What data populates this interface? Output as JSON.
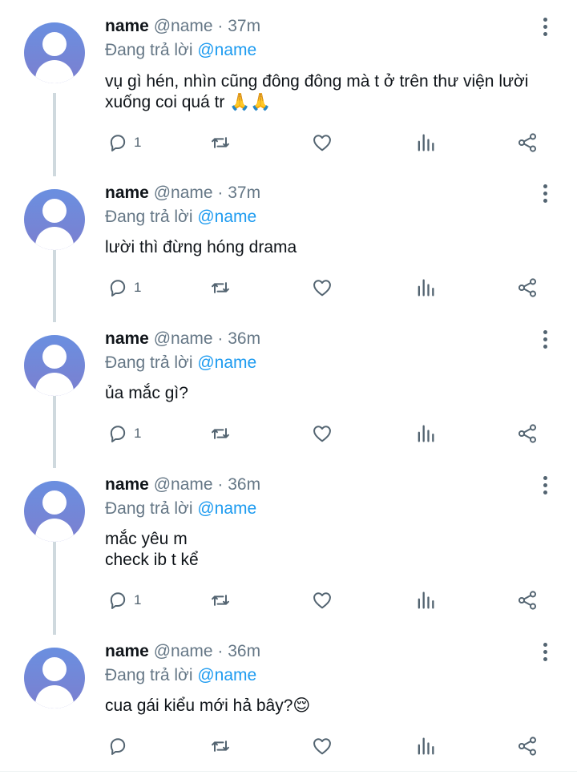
{
  "tweets": [
    {
      "name": "name",
      "handle": "@name · 37m",
      "reply_prefix": "Đang trả lời",
      "reply_to": "@name",
      "text": "vụ gì hén, nhìn cũng đông đông mà t ở trên thư viện lười\nxuống coi quá tr 🙏🙏",
      "reply_count": "1"
    },
    {
      "name": "name",
      "handle": "@name · 37m",
      "reply_prefix": "Đang trả lời",
      "reply_to": "@name",
      "text": "lười thì đừng hóng drama",
      "reply_count": "1"
    },
    {
      "name": "name",
      "handle": "@name · 36m",
      "reply_prefix": "Đang trả lời",
      "reply_to": "@name",
      "text": "ủa mắc gì?",
      "reply_count": "1"
    },
    {
      "name": "name",
      "handle": "@name · 36m",
      "reply_prefix": "Đang trả lời",
      "reply_to": "@name",
      "text": "mắc yêu m\ncheck ib t kể",
      "reply_count": "1"
    },
    {
      "name": "name",
      "handle": "@name · 36m",
      "reply_prefix": "Đang trả lời",
      "reply_to": "@name",
      "text": "cua gái kiểu mới hả bây?😌",
      "reply_count": ""
    }
  ],
  "icons": {
    "reply": "reply-icon",
    "retweet": "retweet-icon",
    "like": "heart-icon",
    "analytics": "analytics-icon",
    "share": "share-icon",
    "more": "more-vertical-icon"
  },
  "colors": {
    "mention": "#1d9bf0",
    "secondary_text": "#657786",
    "icon": "#536471",
    "thread_line": "#cfd9de"
  }
}
